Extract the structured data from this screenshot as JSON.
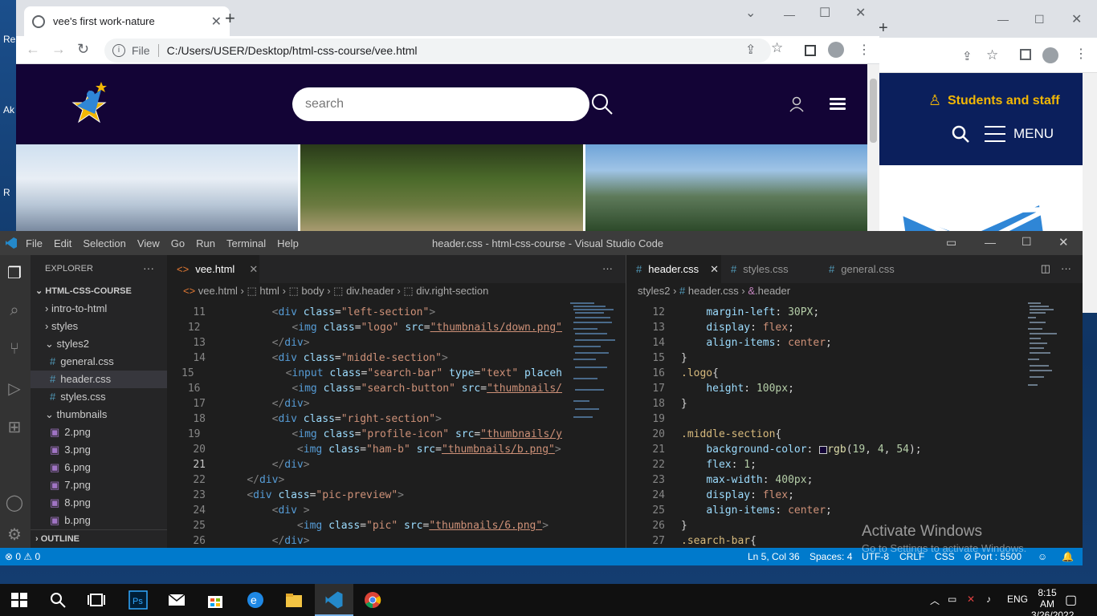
{
  "desktop": {
    "icons": [
      "Re",
      "Ak",
      "R"
    ]
  },
  "back_browser": {
    "site_link": "Students and staff",
    "menu_label": "MENU"
  },
  "browser": {
    "tab_title": "vee's first work-nature",
    "address_prefix": "File",
    "url": "C:/Users/USER/Desktop/html-css-course/vee.html",
    "search_placeholder": "search"
  },
  "vscode": {
    "menu": [
      "File",
      "Edit",
      "Selection",
      "View",
      "Go",
      "Run",
      "Terminal",
      "Help"
    ],
    "window_title": "header.css - html-css-course - Visual Studio Code",
    "explorer_label": "EXPLORER",
    "project": "HTML-CSS-COURSE",
    "tree": [
      {
        "label": "intro-to-html",
        "kind": "folder"
      },
      {
        "label": "styles",
        "kind": "folder"
      },
      {
        "label": "styles2",
        "kind": "folder-open"
      },
      {
        "label": "general.css",
        "kind": "css"
      },
      {
        "label": "header.css",
        "kind": "css",
        "selected": true
      },
      {
        "label": "styles.css",
        "kind": "css"
      },
      {
        "label": "thumbnails",
        "kind": "folder-open"
      },
      {
        "label": "2.png",
        "kind": "png"
      },
      {
        "label": "3.png",
        "kind": "png"
      },
      {
        "label": "6.png",
        "kind": "png"
      },
      {
        "label": "7.png",
        "kind": "png"
      },
      {
        "label": "8.png",
        "kind": "png"
      },
      {
        "label": "b.png",
        "kind": "png"
      }
    ],
    "outline_label": "OUTLINE",
    "left_tab": "vee.html",
    "left_breadcrumb": [
      "vee.html",
      "html",
      "body",
      "div.header",
      "div.right-section"
    ],
    "right_tabs": [
      "header.css",
      "styles.css",
      "general.css"
    ],
    "right_breadcrumb": [
      "styles2",
      "header.css",
      ".header"
    ],
    "html_lines": [
      {
        "n": "11",
        "indent": 8,
        "html": "<span class=\"pu\">&lt;</span><span class=\"tg\">div</span> <span class=\"at\">class</span>=<span class=\"st\">\"left-section\"</span><span class=\"pu\">&gt;</span>"
      },
      {
        "n": "12",
        "indent": 12,
        "html": "<span class=\"pu\">&lt;</span><span class=\"tg\">img</span> <span class=\"at\">class</span>=<span class=\"st\">\"logo\"</span> <span class=\"at\">src</span>=<span class=\"st\" style=\"text-decoration:underline\">\"thumbnails/down.png\"</span>"
      },
      {
        "n": "13",
        "indent": 8,
        "html": "<span class=\"pu\">&lt;/</span><span class=\"tg\">div</span><span class=\"pu\">&gt;</span>"
      },
      {
        "n": "14",
        "indent": 8,
        "html": "<span class=\"pu\">&lt;</span><span class=\"tg\">div</span> <span class=\"at\">class</span>=<span class=\"st\">\"middle-section\"</span><span class=\"pu\">&gt;</span>"
      },
      {
        "n": "15",
        "indent": 12,
        "html": "<span class=\"pu\">&lt;</span><span class=\"tg\">input</span> <span class=\"at\">class</span>=<span class=\"st\">\"search-bar\"</span> <span class=\"at\">type</span>=<span class=\"st\">\"text\"</span> <span class=\"at\">placeh</span>"
      },
      {
        "n": "16",
        "indent": 12,
        "html": "<span class=\"pu\">&lt;</span><span class=\"tg\">img</span> <span class=\"at\">class</span>=<span class=\"st\">\"search-button\"</span> <span class=\"at\">src</span>=<span class=\"st\" style=\"text-decoration:underline\">\"thumbnails/</span>"
      },
      {
        "n": "17",
        "indent": 8,
        "html": "<span class=\"pu\">&lt;/</span><span class=\"tg\">div</span><span class=\"pu\">&gt;</span>"
      },
      {
        "n": "18",
        "indent": 8,
        "html": "<span class=\"pu\">&lt;</span><span class=\"tg\">div</span> <span class=\"at\">class</span>=<span class=\"st\">\"right-section\"</span><span class=\"pu\">&gt;</span>"
      },
      {
        "n": "19",
        "indent": 12,
        "html": "<span class=\"pu\">&lt;</span><span class=\"tg\">img</span> <span class=\"at\">class</span>=<span class=\"st\">\"profile-icon\"</span> <span class=\"at\">src</span>=<span class=\"st\" style=\"text-decoration:underline\">\"thumbnails/y</span>"
      },
      {
        "n": "20",
        "indent": 12,
        "html": "<span class=\"pu\">&lt;</span><span class=\"tg\">img</span> <span class=\"at\">class</span>=<span class=\"st\">\"ham-b\"</span> <span class=\"at\">src</span>=<span class=\"st\" style=\"text-decoration:underline\">\"thumbnails/b.png\"</span><span class=\"pu\">&gt;</span>"
      },
      {
        "n": "21",
        "indent": 8,
        "cur": true,
        "html": "<span class=\"pu\">&lt;/</span><span class=\"tg\">div</span><span class=\"pu\">&gt;</span>"
      },
      {
        "n": "22",
        "indent": 4,
        "html": "<span class=\"pu\">&lt;/</span><span class=\"tg\">div</span><span class=\"pu\">&gt;</span>"
      },
      {
        "n": "23",
        "indent": 4,
        "html": "<span class=\"pu\">&lt;</span><span class=\"tg\">div</span> <span class=\"at\">class</span>=<span class=\"st\">\"pic-preview\"</span><span class=\"pu\">&gt;</span>"
      },
      {
        "n": "24",
        "indent": 8,
        "html": "<span class=\"pu\">&lt;</span><span class=\"tg\">div</span> <span class=\"pu\">&gt;</span>"
      },
      {
        "n": "25",
        "indent": 12,
        "html": "<span class=\"pu\">&lt;</span><span class=\"tg\">img</span> <span class=\"at\">class</span>=<span class=\"st\">\"pic\"</span> <span class=\"at\">src</span>=<span class=\"st\" style=\"text-decoration:underline\">\"thumbnails/6.png\"</span><span class=\"pu\">&gt;</span>"
      },
      {
        "n": "26",
        "indent": 8,
        "html": "<span class=\"pu\">&lt;/</span><span class=\"tg\">div</span><span class=\"pu\">&gt;</span>"
      }
    ],
    "css_lines": [
      {
        "n": "12",
        "indent": 4,
        "html": "<span class=\"pr\">margin-left</span>: <span class=\"nm\">30PX</span>;"
      },
      {
        "n": "13",
        "indent": 4,
        "html": "<span class=\"pr\">display</span>: <span class=\"vl\">flex</span>;"
      },
      {
        "n": "14",
        "indent": 4,
        "html": "<span class=\"pr\">align-items</span>: <span class=\"vl\">center</span>;"
      },
      {
        "n": "15",
        "indent": 0,
        "html": "}"
      },
      {
        "n": "16",
        "indent": 0,
        "html": "<span class=\"sel2\">.logo</span>{"
      },
      {
        "n": "17",
        "indent": 4,
        "html": "<span class=\"pr\">height</span>: <span class=\"nm\">100px</span>;"
      },
      {
        "n": "18",
        "indent": 0,
        "html": "}"
      },
      {
        "n": "19",
        "indent": 0,
        "html": ""
      },
      {
        "n": "20",
        "indent": 0,
        "html": "<span class=\"sel2\">.middle-section</span>{"
      },
      {
        "n": "21",
        "indent": 4,
        "html": "<span class=\"pr\">background-color</span>: <span style=\"display:inline-block;width:10px;height:10px;border:1px solid #ccc;background:#130436;vertical-align:middle\"></span><span class=\"fn\">rgb</span>(<span class=\"nm\">19</span>, <span class=\"nm\">4</span>, <span class=\"nm\">54</span>);"
      },
      {
        "n": "22",
        "indent": 4,
        "html": "<span class=\"pr\">flex</span>: <span class=\"nm\">1</span>;"
      },
      {
        "n": "23",
        "indent": 4,
        "html": "<span class=\"pr\">max-width</span>: <span class=\"nm\">400px</span>;"
      },
      {
        "n": "24",
        "indent": 4,
        "html": "<span class=\"pr\">display</span>: <span class=\"vl\">flex</span>;"
      },
      {
        "n": "25",
        "indent": 4,
        "html": "<span class=\"pr\">align-items</span>: <span class=\"vl\">center</span>;"
      },
      {
        "n": "26",
        "indent": 0,
        "html": "}"
      },
      {
        "n": "27",
        "indent": 0,
        "html": "<span class=\"sel2\">.search-bar</span>{"
      }
    ],
    "status": {
      "errors": "0",
      "warnings": "0",
      "position": "Ln 5, Col 36",
      "spaces": "Spaces: 4",
      "encoding": "UTF-8",
      "eol": "CRLF",
      "language": "CSS",
      "port": "Port : 5500"
    }
  },
  "watermark": {
    "title": "Activate Windows",
    "subtitle": "Go to Settings to activate Windows."
  },
  "taskbar": {
    "time": "8:15 AM",
    "date": "3/26/2022"
  }
}
